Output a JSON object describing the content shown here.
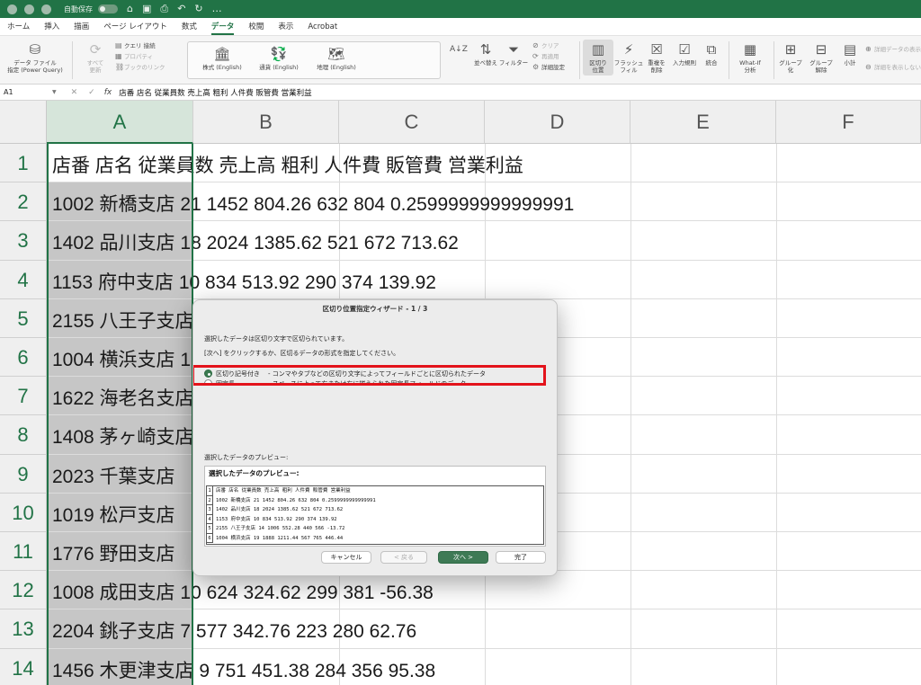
{
  "titlebar": {
    "autosave_label": "自動保存",
    "autosave_state": "オフ"
  },
  "ribbon_tabs": [
    {
      "label": "ホーム",
      "active": false
    },
    {
      "label": "挿入",
      "active": false
    },
    {
      "label": "描画",
      "active": false
    },
    {
      "label": "ページ レイアウト",
      "active": false
    },
    {
      "label": "数式",
      "active": false
    },
    {
      "label": "データ",
      "active": true
    },
    {
      "label": "校閲",
      "active": false
    },
    {
      "label": "表示",
      "active": false
    },
    {
      "label": "Acrobat",
      "active": false
    }
  ],
  "ribbon": {
    "get_data_l1": "データ ファイル",
    "get_data_l2": "指定 (Power Query)",
    "refresh_all_l1": "すべて",
    "refresh_all_l2": "更新",
    "queries": "クエリ 接続",
    "properties": "プロパティ",
    "edit_links": "ブックのリンク",
    "stocks": "株式 (English)",
    "currencies": "通貨 (English)",
    "geography": "地理 (English)",
    "sort": "並べ替え",
    "filter": "フィルター",
    "clear": "クリア",
    "reapply": "再適用",
    "advanced": "詳細設定",
    "text_to_columns_l1": "区切り",
    "text_to_columns_l2": "位置",
    "flash_fill_l1": "フラッシュ",
    "flash_fill_l2": "フィル",
    "remove_dup_l1": "重複を",
    "remove_dup_l2": "削除",
    "data_validation": "入力規則",
    "consolidate": "統合",
    "whatif_l1": "What-If",
    "whatif_l2": "分析",
    "group_l1": "グループ",
    "group_l2": "化",
    "ungroup_l1": "グループ",
    "ungroup_l2": "解除",
    "subtotal": "小計",
    "show_detail": "詳細データの表示",
    "hide_detail": "詳細を表示しない"
  },
  "formula_bar": {
    "cell_ref": "A1",
    "fx": "fx",
    "content": "店番 店名 従業員数 売上高 粗利 人件費 販管費 営業利益"
  },
  "columns": [
    "A",
    "B",
    "C",
    "D",
    "E",
    "F"
  ],
  "selected_column": "A",
  "rows": [
    {
      "num": "1",
      "text": "店番 店名 従業員数 売上高 粗利 人件費 販管費 営業利益"
    },
    {
      "num": "2",
      "text": "1002 新橋支店 21 1452 804.26 632 804 0.2599999999999991"
    },
    {
      "num": "3",
      "text": "1402 品川支店 18 2024 1385.62 521 672 713.62"
    },
    {
      "num": "4",
      "text": "1153 府中支店 10 834 513.92 290 374 139.92"
    },
    {
      "num": "5",
      "text": "2155 八王子支店 14 1006 552.28 440 566 -13.72"
    },
    {
      "num": "6",
      "text": "1004 横浜支店 19 1888 1211.44 567 765 446.44"
    },
    {
      "num": "7",
      "text": "1622 海老名支店"
    },
    {
      "num": "8",
      "text": "1408 茅ヶ崎支店 12"
    },
    {
      "num": "9",
      "text": "2023 千葉支店"
    },
    {
      "num": "10",
      "text": "1019 松戸支店"
    },
    {
      "num": "11",
      "text": "1776 野田支店"
    },
    {
      "num": "12",
      "text": "1008 成田支店 10 624 324.62 299 381 -56.38"
    },
    {
      "num": "13",
      "text": "2204 銚子支店 7 577 342.76 223 280 62.76"
    },
    {
      "num": "14",
      "text": "1456 木更津支店 9 751 451.38 284 356 95.38"
    }
  ],
  "dialog": {
    "title": "区切り位置指定ウィザード - 1 / 3",
    "intro1": "選択したデータは区切り文字で区切られています。",
    "intro2": "[次へ] をクリックするか、区切るデータの形式を指定してください。",
    "option_delimited_label": "区切り記号付き",
    "option_delimited_desc": "- コンマやタブなどの区切り文字によってフィールドごとに区切られたデータ",
    "option_fixed_label": "固定長",
    "option_fixed_desc": "- スペースによって右または左に揃えられた固定長フィールドのデータ",
    "selected_option": "delimited",
    "preview_label": "選択したデータのプレビュー:",
    "preview_heading": "選択したデータのプレビュー:",
    "preview_rows": [
      "店番 店名 従業員数 売上高 粗利 人件費 販管費 営業利益",
      "1002 新橋支店 21 1452 804.26 632 804 0.2599999999999991",
      "1402 品川支店 18 2024 1385.62 521 672 713.62",
      "1153 府中支店 10 834 513.92 290 374 139.92",
      "2155 八王子支店 14 1006 552.28 440 566 -13.72",
      "1004 横浜支店 19 1888 1211.44 567 765 446.44"
    ],
    "cancel": "キャンセル",
    "back": "< 戻る",
    "next": "次へ >",
    "finish": "完了"
  },
  "colors": {
    "excel_green": "#217346",
    "highlight_red": "#e3131b",
    "selected_column_fill": "#c6c6c6"
  }
}
